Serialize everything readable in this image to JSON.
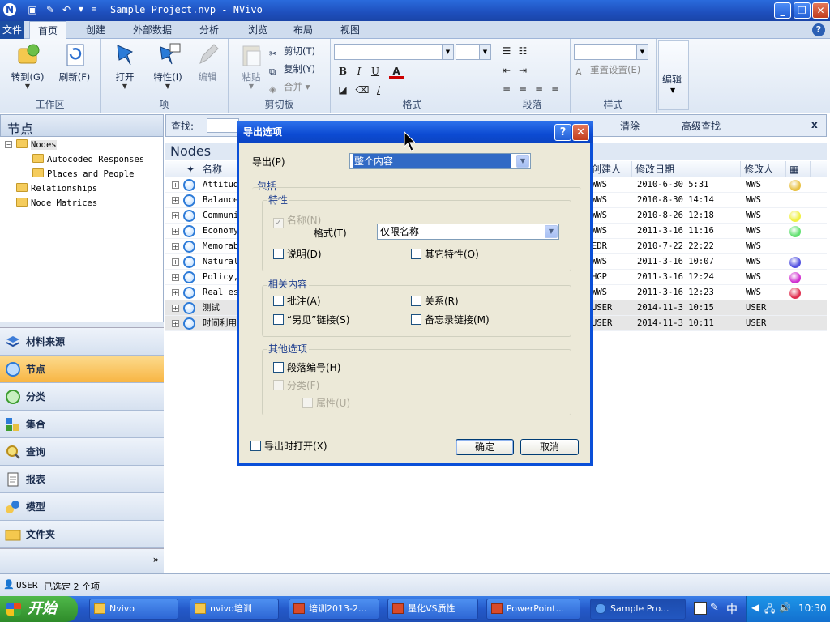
{
  "window": {
    "title": "Sample Project.nvp - NVivo",
    "minimize": "_",
    "maximize": "❐",
    "close": "✕"
  },
  "ribbon": {
    "file_tab": "文件",
    "tabs": [
      {
        "label": "首页",
        "active": true
      },
      {
        "label": "创建"
      },
      {
        "label": "外部数据"
      },
      {
        "label": "分析"
      },
      {
        "label": "浏览"
      },
      {
        "label": "布局"
      },
      {
        "label": "视图"
      }
    ],
    "groups": {
      "workspace": {
        "label": "工作区",
        "goto": "转到(G)",
        "refresh": "刷新(F)"
      },
      "item": {
        "label": "项",
        "open": "打开",
        "properties": "特性(I)",
        "edit": "编辑"
      },
      "clipboard": {
        "label": "剪切板",
        "paste": "粘贴",
        "cut": "剪切(T)",
        "copy": "复制(Y)",
        "merge": "合并"
      },
      "format": {
        "label": "格式",
        "bold": "B",
        "italic": "I",
        "underline": "U",
        "fontcolor": "A"
      },
      "paragraph": {
        "label": "段落"
      },
      "styles": {
        "label": "样式",
        "reset": "重置设置(E)"
      },
      "editing": {
        "label": "编辑"
      }
    }
  },
  "nav": {
    "header": "节点",
    "tree": [
      {
        "label": "Nodes",
        "indent": 0,
        "expand": "−"
      },
      {
        "label": "Autocoded Responses",
        "indent": 1
      },
      {
        "label": "Places and People",
        "indent": 1
      },
      {
        "label": "Relationships",
        "indent": 0
      },
      {
        "label": "Node Matrices",
        "indent": 0
      }
    ],
    "buttons": [
      {
        "label": "材料来源",
        "icon": "sources-icon"
      },
      {
        "label": "节点",
        "icon": "nodes-icon",
        "active": true
      },
      {
        "label": "分类",
        "icon": "classifications-icon"
      },
      {
        "label": "集合",
        "icon": "collections-icon"
      },
      {
        "label": "查询",
        "icon": "queries-icon"
      },
      {
        "label": "报表",
        "icon": "reports-icon"
      },
      {
        "label": "模型",
        "icon": "models-icon"
      },
      {
        "label": "文件夹",
        "icon": "folders-icon"
      }
    ],
    "more": "»"
  },
  "findbar": {
    "find_label": "查找:",
    "clear": "清除",
    "advanced": "高级查找",
    "close": "x"
  },
  "list": {
    "title": "Nodes",
    "columns": {
      "name": "名称",
      "created_by": "创建人",
      "modified_date": "修改日期",
      "modified_by": "修改人"
    },
    "rows": [
      {
        "name": "Attitud",
        "created_by": "WWS",
        "modified": "2010-6-30 5:31",
        "modified_by": "WWS",
        "color": "#e8c040"
      },
      {
        "name": "Balance",
        "created_by": "WWS",
        "modified": "2010-8-30 14:14",
        "modified_by": "WWS",
        "color": ""
      },
      {
        "name": "Communi",
        "created_by": "WWS",
        "modified": "2010-8-26 12:18",
        "modified_by": "WWS",
        "color": "#f0f040"
      },
      {
        "name": "Economy",
        "created_by": "WWS",
        "modified": "2011-3-16 11:16",
        "modified_by": "WWS",
        "color": "#60e070"
      },
      {
        "name": "Memorab",
        "created_by": "EDR",
        "modified": "2010-7-22 22:22",
        "modified_by": "WWS",
        "color": ""
      },
      {
        "name": "Natural",
        "created_by": "WWS",
        "modified": "2011-3-16 10:07",
        "modified_by": "WWS",
        "color": "#5050e0"
      },
      {
        "name": "Policy,",
        "created_by": "HGP",
        "modified": "2011-3-16 12:24",
        "modified_by": "WWS",
        "color": "#d030d0"
      },
      {
        "name": "Real es",
        "created_by": "WWS",
        "modified": "2011-3-16 12:23",
        "modified_by": "WWS",
        "color": "#e03050"
      },
      {
        "name": "测试",
        "created_by": "USER",
        "modified": "2014-11-3 10:15",
        "modified_by": "USER",
        "color": "",
        "selected": true
      },
      {
        "name": "时间利用",
        "created_by": "USER",
        "modified": "2014-11-3 10:11",
        "modified_by": "USER",
        "color": "",
        "selected": true
      }
    ]
  },
  "status": {
    "user": "USER",
    "selection": "已选定 2 个项"
  },
  "dialog": {
    "title": "导出选项",
    "help": "?",
    "close": "✕",
    "export_label": "导出(P)",
    "export_value": "整个内容",
    "include_label": "包括",
    "props_label": "特性",
    "name_chk": "名称(N)",
    "format_label": "格式(T)",
    "format_value": "仅限名称",
    "desc_chk": "说明(D)",
    "other_props_chk": "其它特性(O)",
    "related_label": "相关内容",
    "annotations_chk": "批注(A)",
    "relations_chk": "关系(R)",
    "seealso_chk": "“另见”链接(S)",
    "memo_chk": "备忘录链接(M)",
    "other_label": "其他选项",
    "paranum_chk": "段落编号(H)",
    "classif_chk": "分类(F)",
    "attr_chk": "属性(U)",
    "open_chk": "导出时打开(X)",
    "ok": "确定",
    "cancel": "取消"
  },
  "taskbar": {
    "start": "开始",
    "tasks": [
      {
        "label": "Nvivo"
      },
      {
        "label": "nvivo培训"
      },
      {
        "label": "培训2013-2..."
      },
      {
        "label": "量化VS质性"
      },
      {
        "label": "PowerPoint..."
      },
      {
        "label": "Sample Pro...",
        "active": true
      }
    ],
    "ime": "中",
    "clock": "10:30"
  }
}
